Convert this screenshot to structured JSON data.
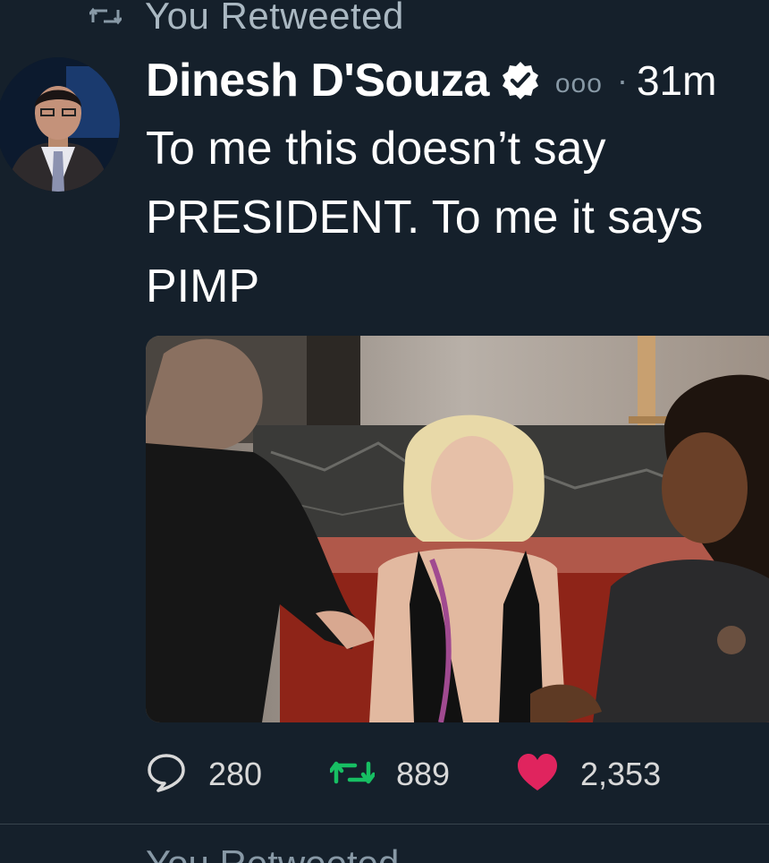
{
  "retweet_context": {
    "label": "You Retweeted",
    "icon": "retweet-icon"
  },
  "tweet": {
    "author": {
      "display_name": "Dinesh D'Souza",
      "verified": true
    },
    "more_menu": "ooo",
    "separator": "·",
    "time_ago": "31m",
    "text_lines": [
      "To me this doesn’t say",
      "PRESIDENT. To me it says",
      "PIMP"
    ],
    "actions": {
      "reply": {
        "icon": "reply-icon",
        "count": "280"
      },
      "retweet": {
        "icon": "retweet-icon",
        "count": "889",
        "color": "#17bf63"
      },
      "like": {
        "icon": "heart-icon",
        "count": "2,353",
        "color": "#e0245e"
      }
    }
  },
  "next_retweet_context": {
    "label": "You Retweeted"
  },
  "colors": {
    "background": "#15202b",
    "muted": "#8899a6",
    "retweet_active": "#17bf63",
    "like_active": "#e0245e"
  }
}
